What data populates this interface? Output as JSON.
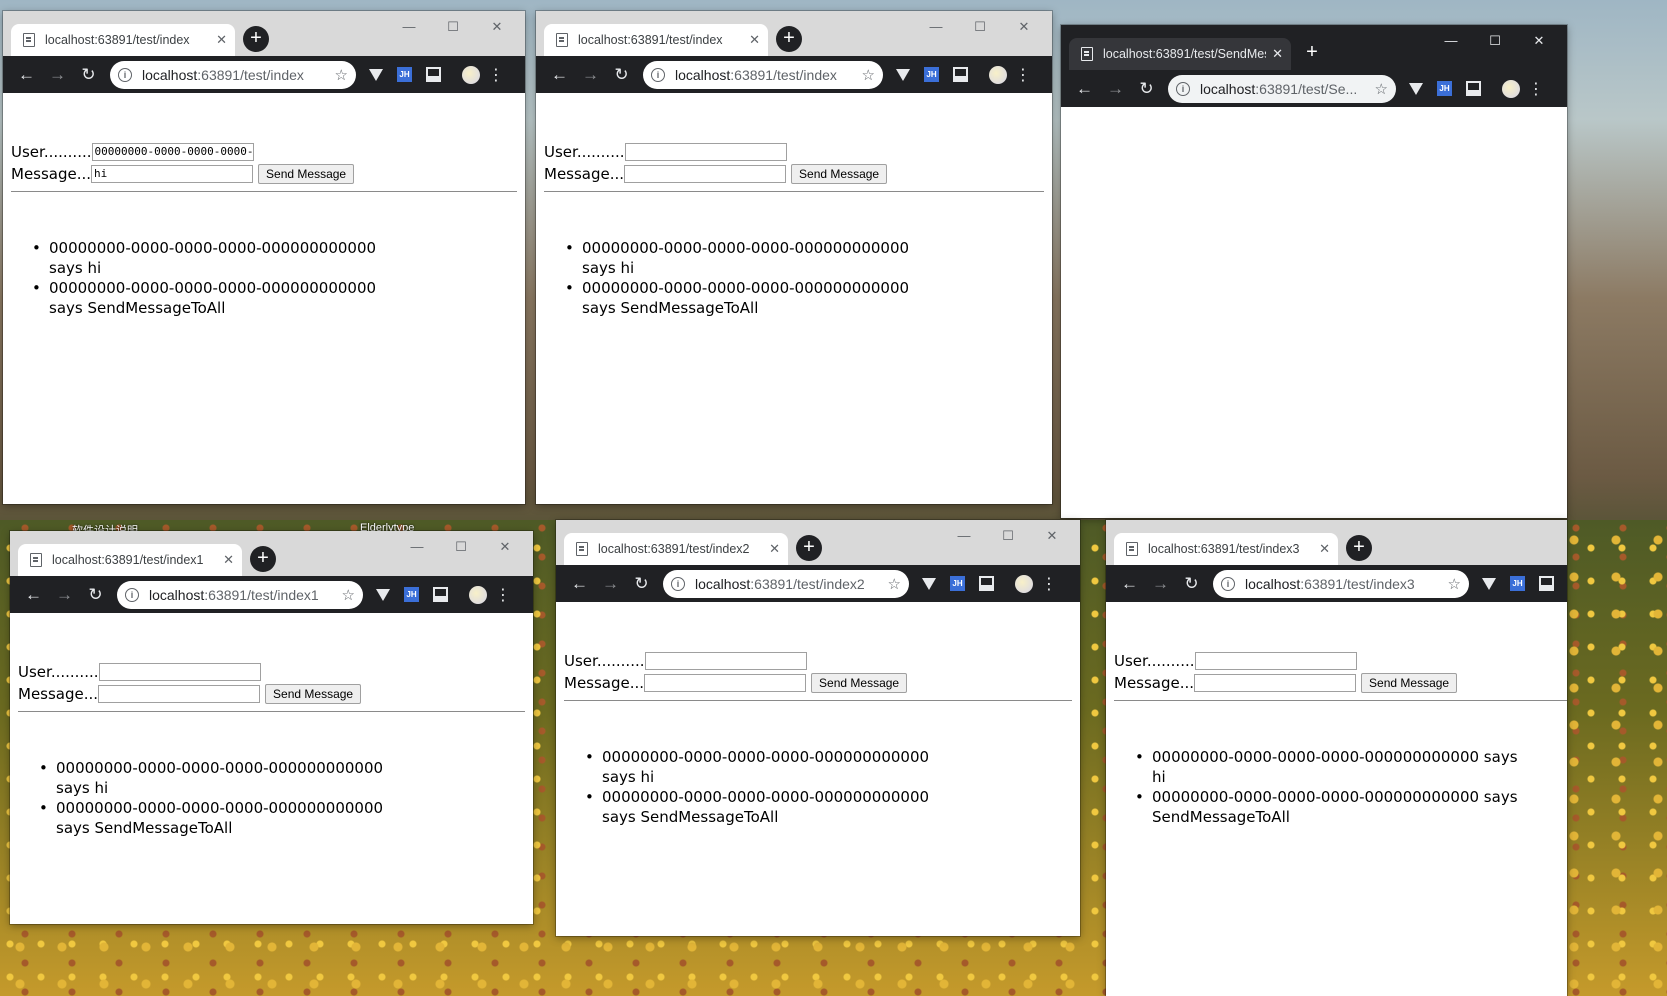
{
  "desktop": {
    "labels": [
      "软件设计说明",
      "Elderlytype"
    ]
  },
  "chrome": {
    "new_tab": "+",
    "close_tab": "✕",
    "minimize": "—",
    "maximize": "☐",
    "close_window": "✕",
    "back": "←",
    "forward": "→",
    "reload": "↻",
    "info": "i",
    "star": "☆",
    "menu": "⋮",
    "ext_jh": "JH"
  },
  "form_labels": {
    "user": "User..........",
    "message": "Message...",
    "send_button": "Send Message"
  },
  "windows": [
    {
      "tab_title": "localhost:63891/test/index",
      "url_host": "localhost",
      "url_rest": ":63891/test/index",
      "user_value": "00000000-0000-0000-0000-0",
      "message_value": "hi",
      "messages": [
        "00000000-0000-0000-0000-000000000000 says hi",
        "00000000-0000-0000-0000-000000000000 says SendMessageToAll"
      ]
    },
    {
      "tab_title": "localhost:63891/test/index",
      "url_host": "localhost",
      "url_rest": ":63891/test/index",
      "user_value": "",
      "message_value": "",
      "messages": [
        "00000000-0000-0000-0000-000000000000 says hi",
        "00000000-0000-0000-0000-000000000000 says SendMessageToAll"
      ]
    },
    {
      "tab_title": "localhost:63891/test/SendMes",
      "url_host": "localhost",
      "url_rest": ":63891/test/Se...",
      "messages": []
    },
    {
      "tab_title": "localhost:63891/test/index1",
      "url_host": "localhost",
      "url_rest": ":63891/test/index1",
      "user_value": "",
      "message_value": "",
      "messages": [
        "00000000-0000-0000-0000-000000000000 says hi",
        "00000000-0000-0000-0000-000000000000 says SendMessageToAll"
      ]
    },
    {
      "tab_title": "localhost:63891/test/index2",
      "url_host": "localhost",
      "url_rest": ":63891/test/index2",
      "user_value": "",
      "message_value": "",
      "messages": [
        "00000000-0000-0000-0000-000000000000 says hi",
        "00000000-0000-0000-0000-000000000000 says SendMessageToAll"
      ]
    },
    {
      "tab_title": "localhost:63891/test/index3",
      "url_host": "localhost",
      "url_rest": ":63891/test/index3",
      "user_value": "",
      "message_value": "",
      "messages": [
        "00000000-0000-0000-0000-000000000000 says hi",
        "00000000-0000-0000-0000-000000000000 says SendMessageToAll"
      ]
    }
  ]
}
